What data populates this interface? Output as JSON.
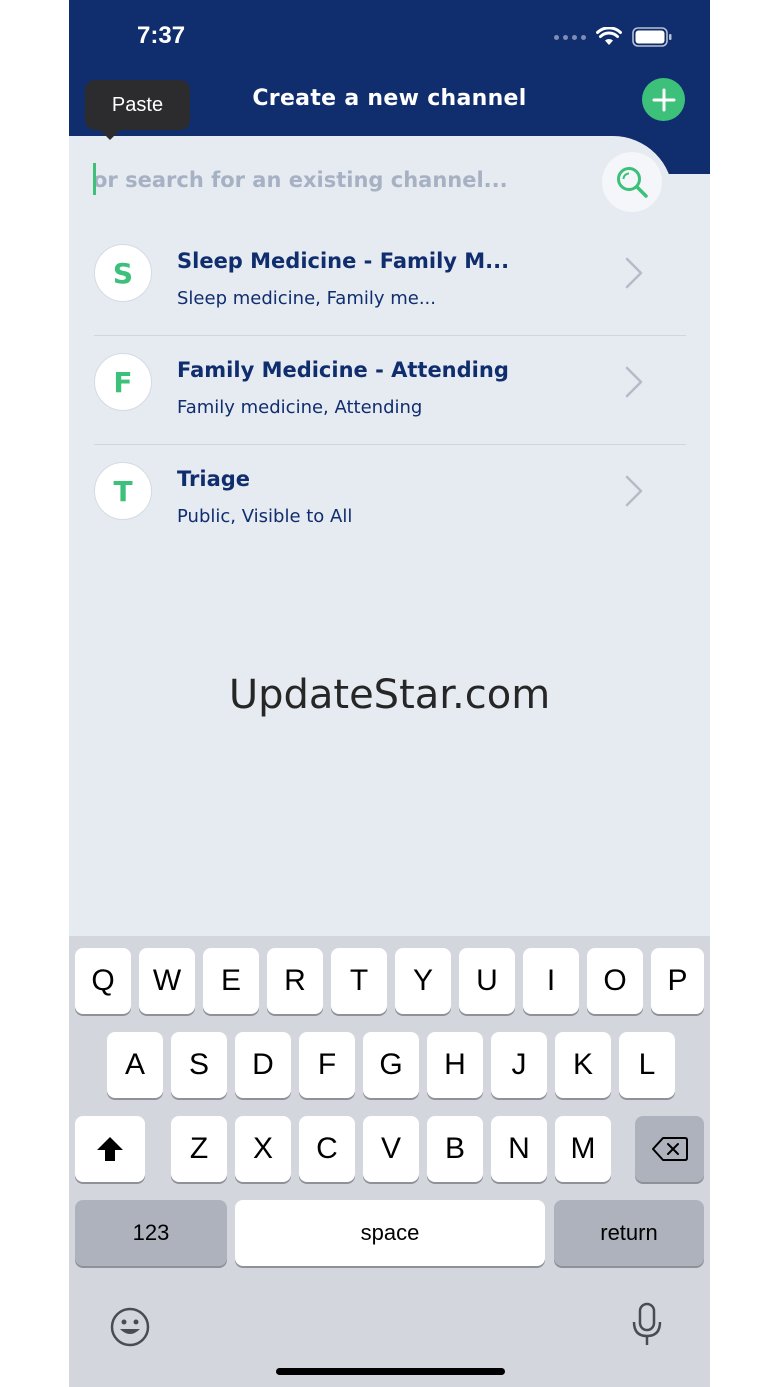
{
  "status_bar": {
    "time": "7:37"
  },
  "header": {
    "title": "Create a new channel"
  },
  "search": {
    "placeholder": "or search for an existing channel..."
  },
  "tooltip": {
    "paste": "Paste"
  },
  "channels": [
    {
      "initial": "S",
      "name": "Sleep Medicine - Family M...",
      "subtitle": "Sleep medicine, Family me..."
    },
    {
      "initial": "F",
      "name": "Family Medicine - Attending",
      "subtitle": "Family medicine, Attending"
    },
    {
      "initial": "T",
      "name": "Triage",
      "subtitle": "Public, Visible to All"
    }
  ],
  "watermark": "UpdateStar.com",
  "keyboard": {
    "row1": [
      "Q",
      "W",
      "E",
      "R",
      "T",
      "Y",
      "U",
      "I",
      "O",
      "P"
    ],
    "row2": [
      "A",
      "S",
      "D",
      "F",
      "G",
      "H",
      "J",
      "K",
      "L"
    ],
    "row3": [
      "Z",
      "X",
      "C",
      "V",
      "B",
      "N",
      "M"
    ],
    "numbers": "123",
    "space": "space",
    "return": "return"
  },
  "colors": {
    "header_bg": "#102d6e",
    "accent": "#3cc07a",
    "background": "#e6ebf1",
    "keyboard_bg": "#d3d6dd"
  }
}
